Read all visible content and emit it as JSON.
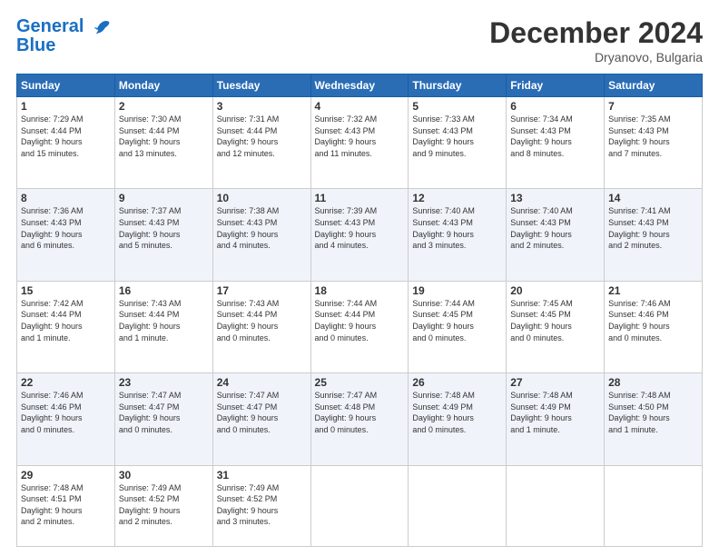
{
  "header": {
    "logo_line1": "General",
    "logo_line2": "Blue",
    "month_title": "December 2024",
    "location": "Dryanovo, Bulgaria"
  },
  "days_of_week": [
    "Sunday",
    "Monday",
    "Tuesday",
    "Wednesday",
    "Thursday",
    "Friday",
    "Saturday"
  ],
  "weeks": [
    [
      {
        "day": "1",
        "info": "Sunrise: 7:29 AM\nSunset: 4:44 PM\nDaylight: 9 hours\nand 15 minutes."
      },
      {
        "day": "2",
        "info": "Sunrise: 7:30 AM\nSunset: 4:44 PM\nDaylight: 9 hours\nand 13 minutes."
      },
      {
        "day": "3",
        "info": "Sunrise: 7:31 AM\nSunset: 4:44 PM\nDaylight: 9 hours\nand 12 minutes."
      },
      {
        "day": "4",
        "info": "Sunrise: 7:32 AM\nSunset: 4:43 PM\nDaylight: 9 hours\nand 11 minutes."
      },
      {
        "day": "5",
        "info": "Sunrise: 7:33 AM\nSunset: 4:43 PM\nDaylight: 9 hours\nand 9 minutes."
      },
      {
        "day": "6",
        "info": "Sunrise: 7:34 AM\nSunset: 4:43 PM\nDaylight: 9 hours\nand 8 minutes."
      },
      {
        "day": "7",
        "info": "Sunrise: 7:35 AM\nSunset: 4:43 PM\nDaylight: 9 hours\nand 7 minutes."
      }
    ],
    [
      {
        "day": "8",
        "info": "Sunrise: 7:36 AM\nSunset: 4:43 PM\nDaylight: 9 hours\nand 6 minutes."
      },
      {
        "day": "9",
        "info": "Sunrise: 7:37 AM\nSunset: 4:43 PM\nDaylight: 9 hours\nand 5 minutes."
      },
      {
        "day": "10",
        "info": "Sunrise: 7:38 AM\nSunset: 4:43 PM\nDaylight: 9 hours\nand 4 minutes."
      },
      {
        "day": "11",
        "info": "Sunrise: 7:39 AM\nSunset: 4:43 PM\nDaylight: 9 hours\nand 4 minutes."
      },
      {
        "day": "12",
        "info": "Sunrise: 7:40 AM\nSunset: 4:43 PM\nDaylight: 9 hours\nand 3 minutes."
      },
      {
        "day": "13",
        "info": "Sunrise: 7:40 AM\nSunset: 4:43 PM\nDaylight: 9 hours\nand 2 minutes."
      },
      {
        "day": "14",
        "info": "Sunrise: 7:41 AM\nSunset: 4:43 PM\nDaylight: 9 hours\nand 2 minutes."
      }
    ],
    [
      {
        "day": "15",
        "info": "Sunrise: 7:42 AM\nSunset: 4:44 PM\nDaylight: 9 hours\nand 1 minute."
      },
      {
        "day": "16",
        "info": "Sunrise: 7:43 AM\nSunset: 4:44 PM\nDaylight: 9 hours\nand 1 minute."
      },
      {
        "day": "17",
        "info": "Sunrise: 7:43 AM\nSunset: 4:44 PM\nDaylight: 9 hours\nand 0 minutes."
      },
      {
        "day": "18",
        "info": "Sunrise: 7:44 AM\nSunset: 4:44 PM\nDaylight: 9 hours\nand 0 minutes."
      },
      {
        "day": "19",
        "info": "Sunrise: 7:44 AM\nSunset: 4:45 PM\nDaylight: 9 hours\nand 0 minutes."
      },
      {
        "day": "20",
        "info": "Sunrise: 7:45 AM\nSunset: 4:45 PM\nDaylight: 9 hours\nand 0 minutes."
      },
      {
        "day": "21",
        "info": "Sunrise: 7:46 AM\nSunset: 4:46 PM\nDaylight: 9 hours\nand 0 minutes."
      }
    ],
    [
      {
        "day": "22",
        "info": "Sunrise: 7:46 AM\nSunset: 4:46 PM\nDaylight: 9 hours\nand 0 minutes."
      },
      {
        "day": "23",
        "info": "Sunrise: 7:47 AM\nSunset: 4:47 PM\nDaylight: 9 hours\nand 0 minutes."
      },
      {
        "day": "24",
        "info": "Sunrise: 7:47 AM\nSunset: 4:47 PM\nDaylight: 9 hours\nand 0 minutes."
      },
      {
        "day": "25",
        "info": "Sunrise: 7:47 AM\nSunset: 4:48 PM\nDaylight: 9 hours\nand 0 minutes."
      },
      {
        "day": "26",
        "info": "Sunrise: 7:48 AM\nSunset: 4:49 PM\nDaylight: 9 hours\nand 0 minutes."
      },
      {
        "day": "27",
        "info": "Sunrise: 7:48 AM\nSunset: 4:49 PM\nDaylight: 9 hours\nand 1 minute."
      },
      {
        "day": "28",
        "info": "Sunrise: 7:48 AM\nSunset: 4:50 PM\nDaylight: 9 hours\nand 1 minute."
      }
    ],
    [
      {
        "day": "29",
        "info": "Sunrise: 7:48 AM\nSunset: 4:51 PM\nDaylight: 9 hours\nand 2 minutes."
      },
      {
        "day": "30",
        "info": "Sunrise: 7:49 AM\nSunset: 4:52 PM\nDaylight: 9 hours\nand 2 minutes."
      },
      {
        "day": "31",
        "info": "Sunrise: 7:49 AM\nSunset: 4:52 PM\nDaylight: 9 hours\nand 3 minutes."
      },
      null,
      null,
      null,
      null
    ]
  ]
}
